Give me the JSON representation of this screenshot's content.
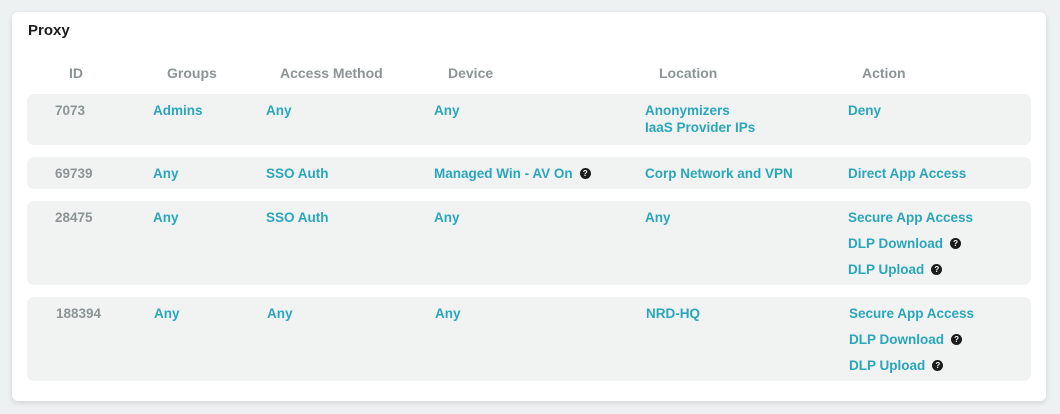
{
  "title": "Proxy",
  "columns": [
    "ID",
    "Groups",
    "Access Method",
    "Device",
    "Location",
    "Action"
  ],
  "rows": [
    {
      "id": "7073",
      "groups": "Admins",
      "access_method": "Any",
      "device": "Any",
      "locations": [
        "Anonymizers",
        "IaaS Provider IPs"
      ],
      "actions": [
        {
          "label": "Deny",
          "help": ""
        }
      ]
    },
    {
      "id": "69739",
      "groups": "Any",
      "access_method": "SSO Auth",
      "device": "Managed Win -  AV On",
      "device_help": "?",
      "locations": [
        "Corp Network and VPN"
      ],
      "actions": [
        {
          "label": "Direct App Access",
          "help": ""
        }
      ]
    },
    {
      "id": "28475",
      "groups": "Any",
      "access_method": "SSO Auth",
      "device": "Any",
      "locations": [
        "Any"
      ],
      "actions": [
        {
          "label": "Secure App Access",
          "help": ""
        },
        {
          "label": "DLP Download",
          "help": "?"
        },
        {
          "label": "DLP Upload",
          "help": "?"
        }
      ]
    },
    {
      "id": "188394",
      "groups": "Any",
      "access_method": "Any",
      "device": "Any",
      "locations": [
        "NRD-HQ"
      ],
      "actions": [
        {
          "label": "Secure App Access",
          "help": ""
        },
        {
          "label": "DLP Download",
          "help": "?"
        },
        {
          "label": "DLP Upload",
          "help": "?"
        }
      ]
    }
  ],
  "colors": {
    "accent": "#2aa6bb",
    "muted": "#8c9496",
    "row_bg": "#f1f3f3",
    "title": "#1c1c1c"
  }
}
